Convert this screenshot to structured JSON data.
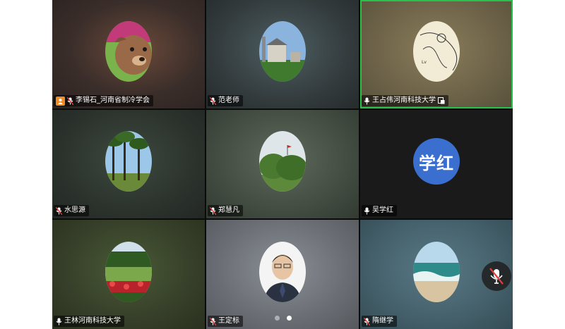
{
  "participants": [
    {
      "name": "李锡石_河南省制冷学会",
      "mic": "muted",
      "host": true,
      "shared": false
    },
    {
      "name": "范老师",
      "mic": "muted",
      "host": false,
      "shared": false
    },
    {
      "name": "王占伟河南科技大学",
      "mic": "on",
      "host": false,
      "shared": true,
      "active_speaker": true
    },
    {
      "name": "水思源",
      "mic": "muted",
      "host": false,
      "shared": false
    },
    {
      "name": "郑慧凡",
      "mic": "muted",
      "host": false,
      "shared": false
    },
    {
      "name": "吴学红",
      "mic": "on",
      "host": false,
      "shared": false,
      "avatar_text": "学红"
    },
    {
      "name": "王林河南科技大学",
      "mic": "on",
      "host": false,
      "shared": false
    },
    {
      "name": "王定标",
      "mic": "muted",
      "host": false,
      "shared": false
    },
    {
      "name": "隋继学",
      "mic": "muted",
      "host": false,
      "shared": false
    }
  ],
  "pagination": {
    "pages": 2,
    "current": 2
  },
  "controls": {
    "mute_button_icon": "mic-muted-icon"
  },
  "colors": {
    "active_border": "#27c24c",
    "host_badge": "#f08a24",
    "avatar_text_bg": "#3a6fd0"
  }
}
